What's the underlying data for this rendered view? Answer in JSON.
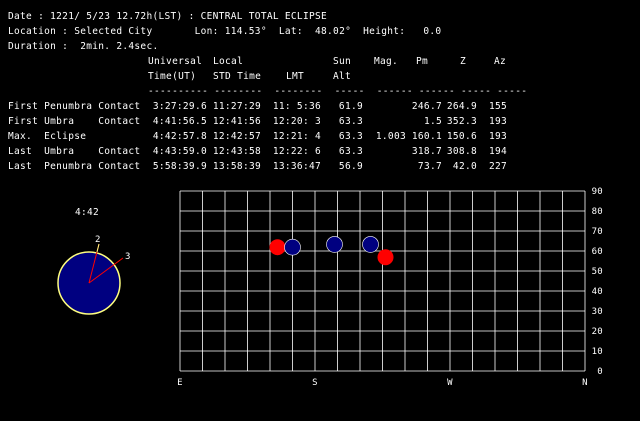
{
  "header": {
    "date_line": "Date : 1221/ 5/23 12.72h(LST) : CENTRAL TOTAL ECLIPSE",
    "location_line": "Location : Selected City       Lon: 114.53°  Lat:  48.02°  Height:   0.0",
    "duration_line": "Duration :  2min. 2.4sec."
  },
  "table": {
    "head1": [
      "Universal",
      "Local",
      "",
      "Sun",
      "Mag.",
      "Pm",
      "Z",
      "Az"
    ],
    "head2": [
      "Time(UT)",
      "STD Time",
      "LMT",
      "Alt",
      "",
      "",
      "",
      ""
    ],
    "separator": "---------- --------  --------  -----  ------ ------ ----- -----",
    "rows": [
      {
        "event": "First Penumbra Contact",
        "ut": "3:27:29.6",
        "std": "11:27:29",
        "lmt": "11: 5:36",
        "alt": "61.9",
        "mag": "",
        "pm": "246.7",
        "z": "264.9",
        "az": "155"
      },
      {
        "event": "First Umbra    Contact",
        "ut": "4:41:56.5",
        "std": "12:41:56",
        "lmt": "12:20: 3",
        "alt": "63.3",
        "mag": "",
        "pm": "1.5",
        "z": "352.3",
        "az": "193"
      },
      {
        "event": "Max.  Eclipse",
        "ut": "4:42:57.8",
        "std": "12:42:57",
        "lmt": "12:21: 4",
        "alt": "63.3",
        "mag": "1.003",
        "pm": "160.1",
        "z": "150.6",
        "az": "193"
      },
      {
        "event": "Last  Umbra    Contact",
        "ut": "4:43:59.0",
        "std": "12:43:58",
        "lmt": "12:22: 6",
        "alt": "63.3",
        "mag": "",
        "pm": "318.7",
        "z": "308.8",
        "az": "194"
      },
      {
        "event": "Last  Penumbra Contact",
        "ut": "5:58:39.9",
        "std": "13:58:39",
        "lmt": "13:36:47",
        "alt": "56.9",
        "mag": "",
        "pm": "73.7",
        "z": "42.0",
        "az": "227"
      }
    ]
  },
  "sun_disk": {
    "time_label": "4:42",
    "contact_labels": [
      "2",
      "3"
    ],
    "disk_color": "#000080",
    "rim_color": "#ffff80",
    "line_color": "#ff0000"
  },
  "chart_data": {
    "type": "scatter",
    "x_ticks": [
      "E",
      "S",
      "W",
      "N"
    ],
    "y_ticks": [
      0,
      10,
      20,
      30,
      40,
      50,
      60,
      70,
      80,
      90
    ],
    "xlim": [
      90,
      360
    ],
    "ylim": [
      0,
      90
    ],
    "grid": true,
    "series": [
      {
        "color": "#ff0000",
        "points": [
          {
            "az": 155,
            "alt": 61.9
          },
          {
            "az": 227,
            "alt": 56.9
          }
        ]
      },
      {
        "color": "#000080",
        "points": [
          {
            "az": 165,
            "alt": 61.9
          },
          {
            "az": 193,
            "alt": 63.3
          },
          {
            "az": 217,
            "alt": 63.3
          }
        ]
      }
    ]
  },
  "colors": {
    "background": "#000000",
    "text": "#ffffff",
    "grid": "#ffffff",
    "penumbra": "#ff0000",
    "sun": "#000080"
  }
}
